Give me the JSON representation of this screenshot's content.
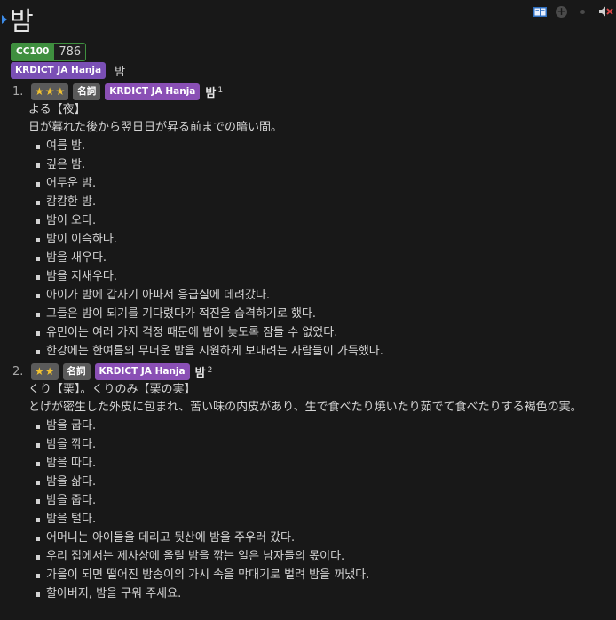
{
  "headword": "밤",
  "icons": {
    "add_anki": "book-icon",
    "add_note": "plus-icon",
    "dot": "dot-icon",
    "audio": "speaker-icon"
  },
  "frequency": {
    "tag": "CC100",
    "value": "786"
  },
  "dictionary": {
    "tag": "KRDICT JA Hanja",
    "reading": "밤"
  },
  "entries": [
    {
      "num": "1.",
      "stars": 3,
      "pos": "名詞",
      "source": "KRDICT JA Hanja",
      "word": "밤",
      "sup": "1",
      "gloss1": "よる【夜】",
      "gloss2": "日が暮れた後から翌日日が昇る前までの暗い間。",
      "examples": [
        "여름 밤.",
        "깊은 밤.",
        "어두운 밤.",
        "캄캄한 밤.",
        "밤이 오다.",
        "밤이 이슥하다.",
        "밤을 새우다.",
        "밤을 지새우다.",
        "아이가 밤에 갑자기 아파서 응급실에 데려갔다.",
        "그들은 밤이 되기를 기다렸다가 적진을 습격하기로 했다.",
        "유민이는 여러 가지 걱정 때문에 밤이 늦도록 잠들 수 없었다.",
        "한강에는 한여름의 무더운 밤을 시원하게 보내려는 사람들이 가득했다."
      ]
    },
    {
      "num": "2.",
      "stars": 2,
      "pos": "名詞",
      "source": "KRDICT JA Hanja",
      "word": "밤",
      "sup": "2",
      "gloss1": "くり【栗】。くりのみ【栗の実】",
      "gloss2": "とげが密生した外皮に包まれ、苦い味の内皮があり、生で食べたり焼いたり茹でて食べたりする褐色の実。",
      "examples": [
        "밤을 굽다.",
        "밤을 깎다.",
        "밤을 따다.",
        "밤을 삶다.",
        "밤을 줍다.",
        "밤을 털다.",
        "어머니는 아이들을 데리고 뒷산에 밤을 주우러 갔다.",
        "우리 집에서는 제사상에 올릴 밤을 깎는 일은 남자들의 몫이다.",
        "가을이 되면 떨어진 밤송이의 가시 속을 막대기로 벌려 밤을 꺼냈다.",
        "할아버지, 밤을 구워 주세요."
      ]
    }
  ]
}
